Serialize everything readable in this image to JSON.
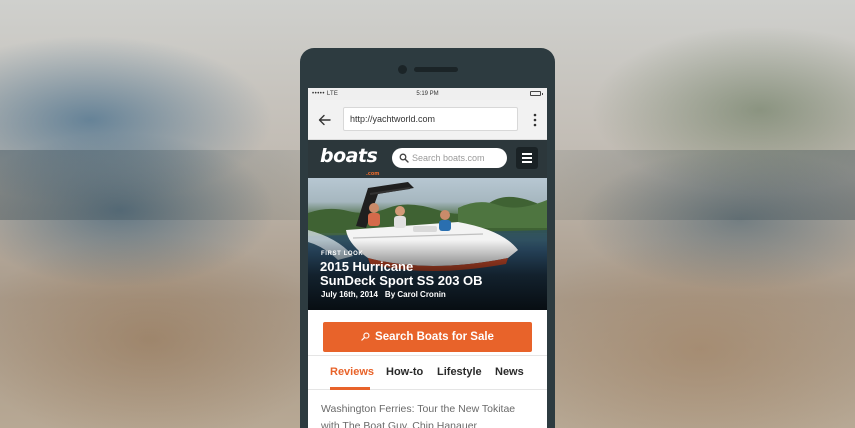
{
  "status_bar": {
    "carrier": "LTE",
    "time": "5:19 PM"
  },
  "browser": {
    "url": "http://yachtworld.com"
  },
  "site": {
    "logo_text": "boats",
    "logo_sub": ".com",
    "search_placeholder": "Search boats.com"
  },
  "hero": {
    "kicker": "FIRST LOOK",
    "title_line1": "2015 Hurricane",
    "title_line2": "SunDeck Sport SS 203 OB",
    "date": "July 16th, 2014",
    "author": "By Carol Cronin"
  },
  "cta": {
    "label": "Search Boats for Sale"
  },
  "tabs": [
    {
      "label": "Reviews",
      "active": true
    },
    {
      "label": "How-to",
      "active": false
    },
    {
      "label": "Lifestyle",
      "active": false
    },
    {
      "label": "News",
      "active": false
    }
  ],
  "article": {
    "line1": "Washington Ferries: Tour the New Tokitae",
    "line2": "with The Boat Guy, Chip Hanauer"
  },
  "colors": {
    "accent": "#e8632a",
    "header_bg": "#2c373b"
  }
}
